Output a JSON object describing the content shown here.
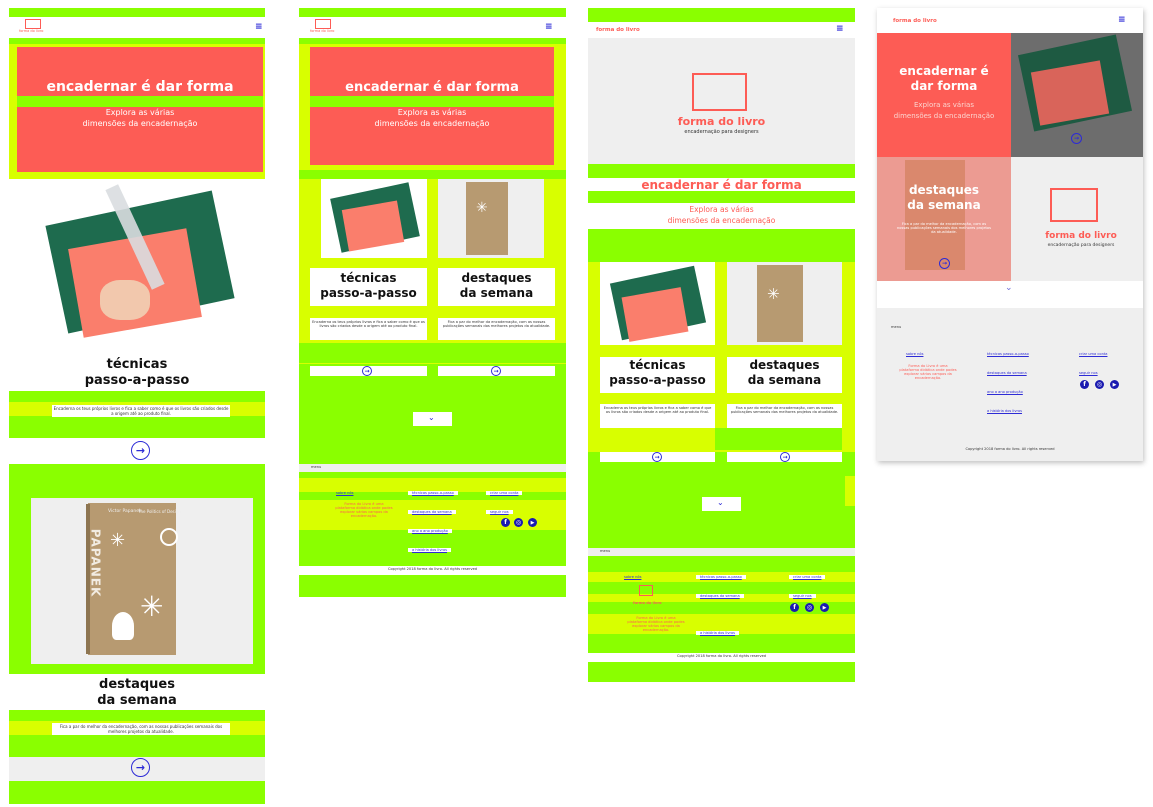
{
  "brand": {
    "name": "forma do livro",
    "tagline": "encadernação para designers",
    "logo_small_text": "forma do livro"
  },
  "hero": {
    "title": "encadernar é dar forma",
    "title_line1": "encadernar é",
    "title_line2": "dar forma",
    "subtitle_line1": "Explora as várias",
    "subtitle_line2": "dimensões da encadernação"
  },
  "techniques": {
    "title_line1": "técnicas",
    "title_line2": "passo-a-passo",
    "desc": "Encaderna os teus próprios livros e fica a saber como é que os livros são criados desde a origem até ao produto final.",
    "desc_l1": "Encaderna os teus próprios livros e fica a",
    "desc_l2": "saber como é que os livros são criados",
    "desc_l3": "desde a origem até ao produto final."
  },
  "highlights": {
    "title_line1": "destaques",
    "title_line2": "da semana",
    "desc": "Fica a par do melhor da encadernação, com as nossas publicações semanais dos melhores projetos da atualidade.",
    "desc_l1": "Fica a par do melhor da",
    "desc_l2": "encadernação, com as nossas",
    "desc_l3": "publicações semanais dos melhores",
    "desc_l4": "projetos da atualidade."
  },
  "book": {
    "author": "Victor Papanek",
    "subtitle": "The Politics of Design",
    "spine": "PAPANEK"
  },
  "footer": {
    "menu_label": "menu",
    "about_label": "sobre nós",
    "about_text": "Forma do Livro é uma plataforma didática onde podes explorar vários campos da encadernação.",
    "about_l1": "Forma do Livro é uma",
    "about_l2": "plataforma didática onde",
    "about_l3": "podes explorar vários",
    "about_l4": "campos da encadernação.",
    "links": [
      "técnicas passo-a-passo",
      "destaques da semana",
      "ano a ano produção",
      "a história dos livros"
    ],
    "contact": "criar uma conta",
    "follow": "seguir nos",
    "social": [
      "f",
      "◎",
      "▶"
    ],
    "copyright": "Copyright 2018 forma do livro. All rights reserved"
  },
  "icons": {
    "menu": "hamburger-icon",
    "arrow": "arrow-circle-right-icon",
    "chevron": "chevron-down-icon",
    "copyright": "copyright-icon"
  },
  "colors": {
    "coral": "#fd5c55",
    "green": "#8aff00",
    "yellow": "#d8ff00",
    "blue": "#2d2bd6",
    "gray": "#efefef"
  }
}
